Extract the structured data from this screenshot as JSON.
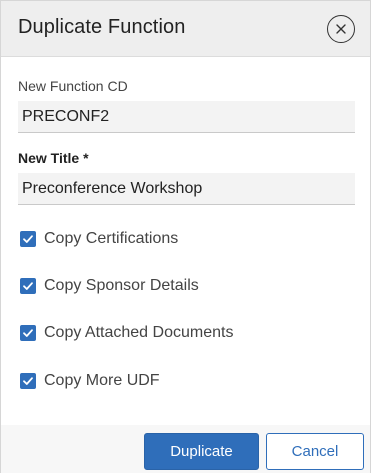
{
  "dialog": {
    "title": "Duplicate Function",
    "close_icon": "close-circle-icon"
  },
  "form": {
    "function_cd": {
      "label": "New Function CD",
      "value": "PRECONF2"
    },
    "title": {
      "label": "New Title *",
      "value": "Preconference Workshop"
    },
    "options": [
      {
        "label": "Copy Certifications",
        "checked": true
      },
      {
        "label": "Copy Sponsor Details",
        "checked": true
      },
      {
        "label": "Copy Attached Documents",
        "checked": true
      },
      {
        "label": "Copy More UDF",
        "checked": true
      }
    ]
  },
  "footer": {
    "duplicate_label": "Duplicate",
    "cancel_label": "Cancel"
  },
  "colors": {
    "accent": "#2f6eba",
    "header_bg": "#eeeeee",
    "field_bg": "#f3f3f3"
  }
}
